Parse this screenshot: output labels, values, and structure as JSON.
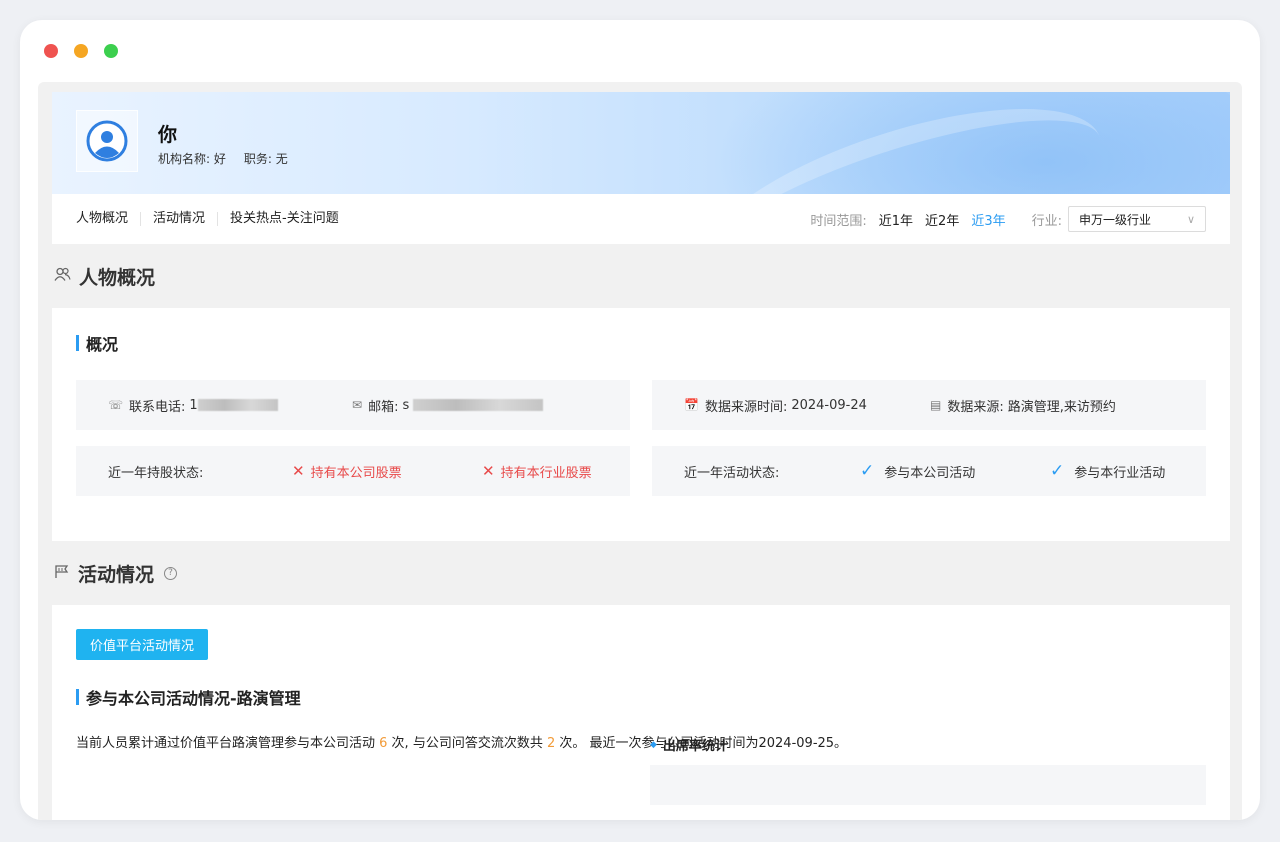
{
  "profile": {
    "name": "你",
    "org_label": "机构名称: 好",
    "title_label": "职务: 无"
  },
  "tabs": [
    "人物概况",
    "活动情况",
    "投关热点-关注问题"
  ],
  "time_range": {
    "label": "时间范围:",
    "options": [
      "近1年",
      "近2年",
      "近3年"
    ],
    "active": "近3年"
  },
  "industry": {
    "label": "行业:",
    "selected": "申万一级行业"
  },
  "overview": {
    "section_title": "人物概况",
    "sub_title": "概况",
    "phone_label": "联系电话:",
    "phone_value": "1",
    "email_label": "邮箱:",
    "email_value": "s",
    "source_time_label": "数据来源时间:",
    "source_time_value": "2024-09-24",
    "source_label": "数据来源:",
    "source_value": "路演管理,来访预约",
    "holding_label": "近一年持股状态:",
    "holding_company": "持有本公司股票",
    "holding_industry": "持有本行业股票",
    "activity_label": "近一年活动状态:",
    "activity_company": "参与本公司活动",
    "activity_industry": "参与本行业活动"
  },
  "activity": {
    "section_title": "活动情况",
    "pill_label": "价值平台活动情况",
    "sub_title": "参与本公司活动情况-路演管理",
    "summary_a": "当前人员累计通过价值平台路演管理参与本公司活动 ",
    "count_activity": "6",
    "summary_b": " 次,  与公司问答交流次数共 ",
    "count_qa": "2",
    "summary_c": " 次。 最近一次参与公司活动时间为2024-09-25。",
    "stat_title": "出席率统计"
  },
  "colors": {
    "accent": "#2b9cf2",
    "red": "#e84a4a",
    "orange": "#f29b38",
    "pill": "#1fb3f0"
  }
}
